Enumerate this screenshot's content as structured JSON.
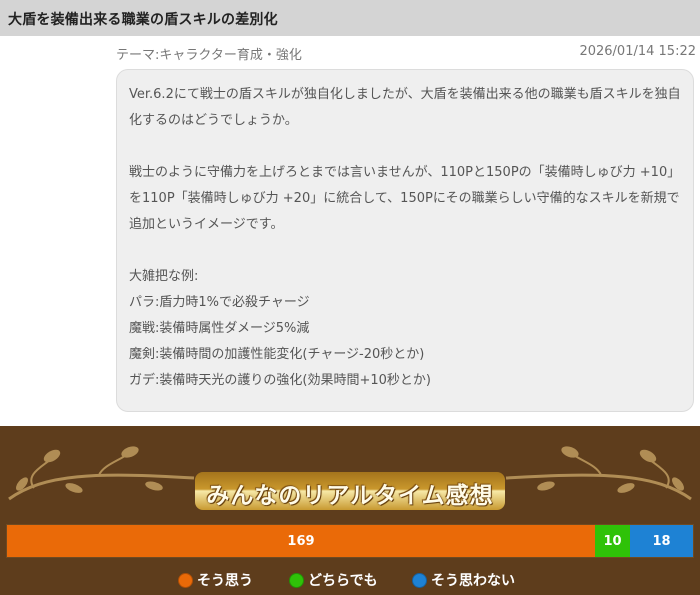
{
  "topic": {
    "title": "大盾を装備出来る職業の盾スキルの差別化",
    "theme": "テーマ:キャラクター育成・強化",
    "date": "2026/01/14 15:22"
  },
  "post": {
    "paragraph1": "Ver.6.2にて戦士の盾スキルが独自化しましたが、大盾を装備出来る他の職業も盾スキルを独自化するのはどうでしょうか。",
    "paragraph2": "戦士のように守備力を上げろとまでは言いませんが、110Pと150Pの「装備時しゅび力 +10」を110P「装備時しゅび力 +20」に統合して、150Pにその職業らしい守備的なスキルを新規で追加というイメージです。",
    "paragraph3": "大雑把な例:\nパラ:盾力時1%で必殺チャージ\n魔戦:装備時属性ダメージ5%減\n魔剣:装備時間の加護性能変化(チャージ-20秒とか)\nガデ:装備時天光の護りの強化(効果時間+10秒とか)"
  },
  "poll": {
    "heading": "みんなのリアルタイム感想",
    "colors": {
      "agree": "#ea6a08",
      "neutral": "#2fc208",
      "disagree": "#1e82d4"
    },
    "agree_count": 169,
    "neutral_count": 10,
    "disagree_count": 18,
    "agree_label": "そう思う",
    "neutral_label": "どちらでも",
    "disagree_label": "そう思わない"
  }
}
